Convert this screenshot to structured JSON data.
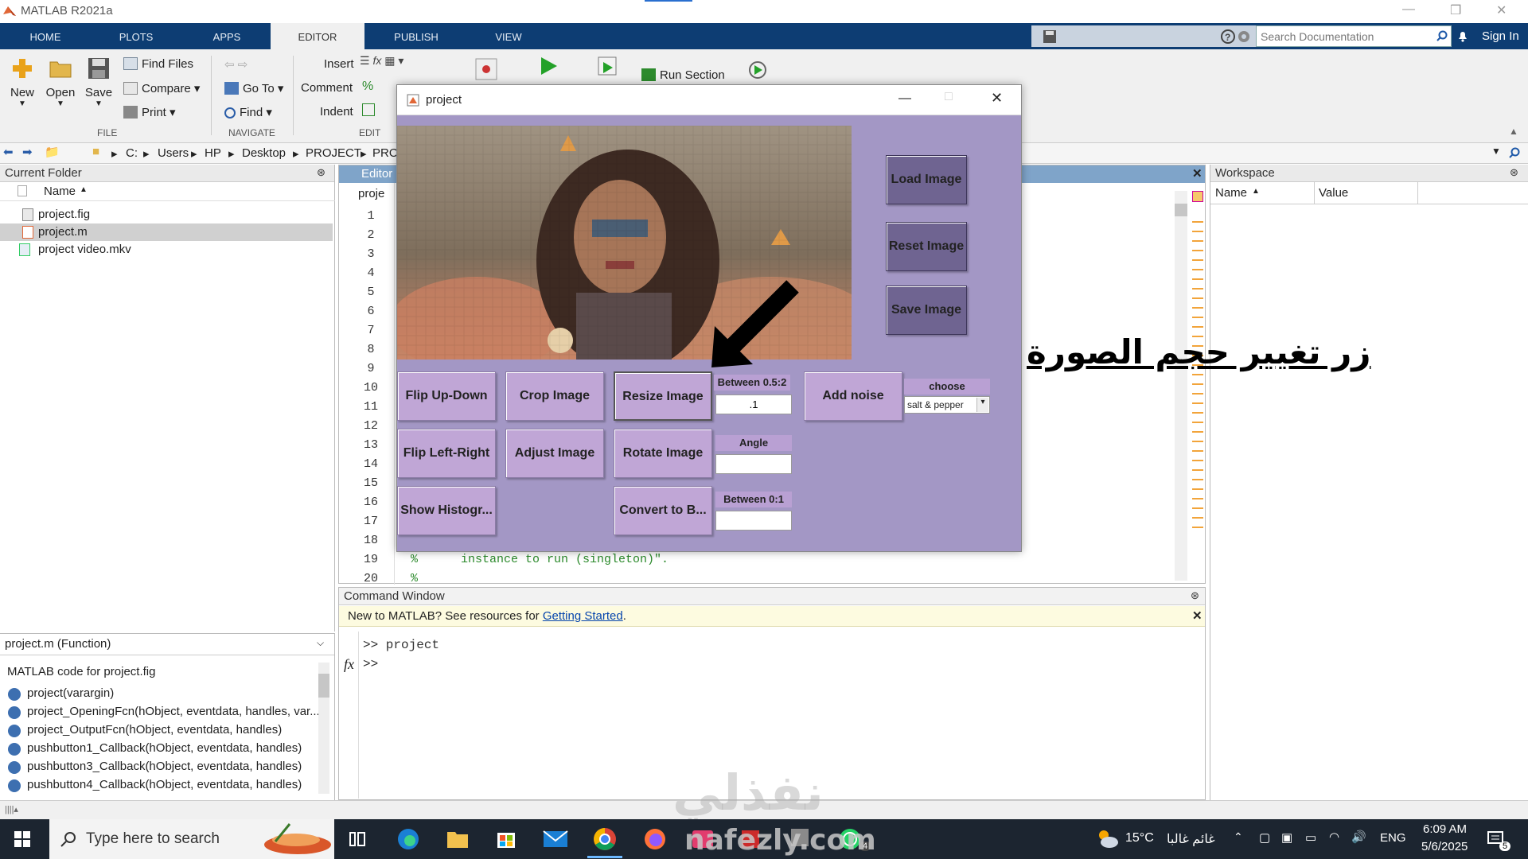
{
  "window": {
    "title": "MATLAB R2021a"
  },
  "ribbon": {
    "tabs": [
      {
        "label": "HOME"
      },
      {
        "label": "PLOTS"
      },
      {
        "label": "APPS"
      },
      {
        "label": "EDITOR"
      },
      {
        "label": "PUBLISH"
      },
      {
        "label": "VIEW"
      }
    ],
    "active_tab": "EDITOR",
    "search_placeholder": "Search Documentation",
    "sign_in": "Sign In"
  },
  "toolstrip": {
    "file": {
      "new": "New",
      "open": "Open",
      "save": "Save",
      "find_files": "Find Files",
      "compare": "Compare",
      "print": "Print",
      "group": "FILE"
    },
    "navigate": {
      "go_to": "Go To",
      "find": "Find",
      "group": "NAVIGATE"
    },
    "edit": {
      "insert": "Insert",
      "comment": "Comment",
      "indent": "Indent",
      "group": "EDIT"
    },
    "run": {
      "run_section": "Run Section"
    }
  },
  "address": {
    "path": [
      "C:",
      "Users",
      "HP",
      "Desktop",
      "PROJECT",
      "PRO"
    ]
  },
  "current_folder": {
    "title": "Current Folder",
    "column": "Name",
    "files": [
      {
        "name": "project.fig"
      },
      {
        "name": "project.m"
      },
      {
        "name": "project video.mkv"
      }
    ]
  },
  "details": {
    "header": "project.m  (Function)",
    "description": "MATLAB code for project.fig",
    "functions": [
      "project(varargin)",
      "project_OpeningFcn(hObject, eventdata, handles, var...",
      "project_OutputFcn(hObject, eventdata, handles)",
      "pushbutton1_Callback(hObject, eventdata, handles)",
      "pushbutton3_Callback(hObject, eventdata, handles)",
      "pushbutton4_Callback(hObject, eventdata, handles)"
    ]
  },
  "editor": {
    "title": "Editor",
    "tab": "proje",
    "line_numbers": [
      "1",
      "2",
      "3",
      "4",
      "5",
      "6",
      "7",
      "8",
      "9",
      "10",
      "11",
      "12",
      "13",
      "14",
      "15",
      "16",
      "17",
      "18",
      "19",
      "20"
    ],
    "code_line_19": "%      instance to run (singleton)\".",
    "code_line_20": "%"
  },
  "command_window": {
    "title": "Command Window",
    "banner_text": "New to MATLAB? See resources for ",
    "banner_link": "Getting Started",
    "banner_end": ".",
    "lines": [
      ">> project",
      ">>"
    ],
    "fx": "fx"
  },
  "workspace": {
    "title": "Workspace",
    "col_name": "Name",
    "col_value": "Value"
  },
  "figure": {
    "title": "project",
    "buttons": {
      "load": "Load Image",
      "reset": "Reset Image",
      "save": "Save Image",
      "flip_ud": "Flip Up-Down",
      "crop": "Crop Image",
      "resize": "Resize Image",
      "add_noise": "Add noise",
      "flip_lr": "Flip Left-Right",
      "adjust": "Adjust Image",
      "rotate": "Rotate Image",
      "histogram": "Show Histogr...",
      "convert": "Convert to B..."
    },
    "labels": {
      "resize_range": "Between 0.5:2",
      "angle": "Angle",
      "bw_range": "Between 0:1",
      "choose": "choose"
    },
    "inputs": {
      "resize_value": ".1",
      "angle_value": "",
      "bw_value": ""
    },
    "noise_select": "salt & pepper"
  },
  "annotation": {
    "arabic_label": "زر تغيير حجم الصورة"
  },
  "watermark": {
    "arabic": "نفذلي",
    "latin": "nafezly.com"
  },
  "taskbar": {
    "search_placeholder": "Type here to search",
    "weather": "15°C",
    "weather_desc": "غائم غالبا",
    "lang": "ENG",
    "time": "6:09 AM",
    "date": "5/6/2025",
    "whatsapp_badge": "4",
    "notif_badge": "5"
  },
  "colors": {
    "ribbon_bg": "#0d3d73",
    "figure_bg": "#a397c5",
    "button_bg": "#c0a6d6",
    "dark_button_bg": "#6f6491",
    "editor_header": "#7fa4c9"
  }
}
